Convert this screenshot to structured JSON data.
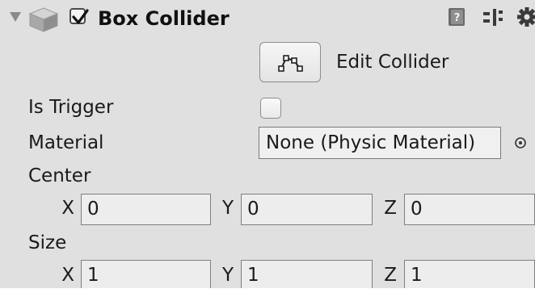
{
  "component": {
    "title": "Box Collider",
    "enabled": true
  },
  "edit_collider": {
    "label": "Edit Collider",
    "icon": "edit-collider-icon"
  },
  "fields": {
    "is_trigger": {
      "label": "Is Trigger",
      "checked": false
    },
    "material": {
      "label": "Material",
      "value": "None (Physic Material)"
    },
    "center": {
      "label": "Center",
      "x_label": "X",
      "x": "0",
      "y_label": "Y",
      "y": "0",
      "z_label": "Z",
      "z": "0"
    },
    "size": {
      "label": "Size",
      "x_label": "X",
      "x": "1",
      "y_label": "Y",
      "y": "1",
      "z_label": "Z",
      "z": "1"
    }
  },
  "header_icons": [
    "foldout-arrow-icon",
    "cube-icon",
    "help-book-icon",
    "presets-icon",
    "gear-icon"
  ],
  "colors": {
    "panel_background": "#e0e0e0",
    "field_background": "#ededed",
    "field_border": "#7e7e7e"
  }
}
